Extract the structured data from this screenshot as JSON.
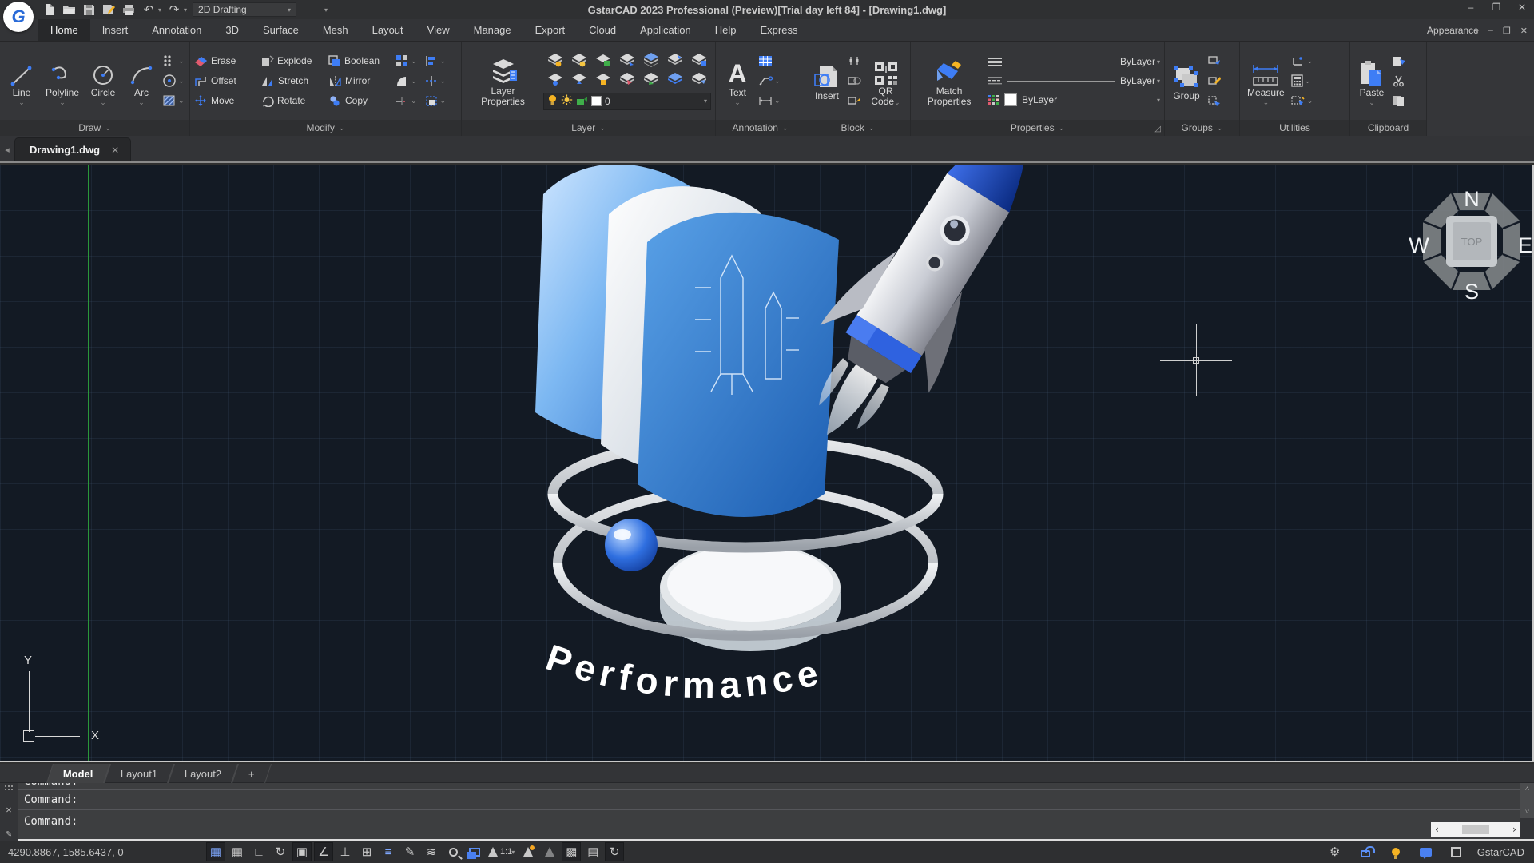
{
  "titlebar": {
    "title": "GstarCAD 2023 Professional (Preview)[Trial day left 84] - [Drawing1.dwg]",
    "workspace": "2D Drafting",
    "logo": "G"
  },
  "menubar": {
    "items": [
      "Home",
      "Insert",
      "Annotation",
      "3D",
      "Surface",
      "Mesh",
      "Layout",
      "View",
      "Manage",
      "Export",
      "Cloud",
      "Application",
      "Help",
      "Express"
    ],
    "appearance": "Appearance"
  },
  "ribbon": {
    "draw": {
      "label": "Draw",
      "line": "Line",
      "polyline": "Polyline",
      "circle": "Circle",
      "arc": "Arc"
    },
    "modify": {
      "label": "Modify",
      "erase": "Erase",
      "explode": "Explode",
      "boolean": "Boolean",
      "offset": "Offset",
      "stretch": "Stretch",
      "mirror": "Mirror",
      "move": "Move",
      "rotate": "Rotate",
      "copy": "Copy"
    },
    "layer": {
      "label": "Layer",
      "properties": "Layer Properties",
      "current": "0"
    },
    "annotation": {
      "label": "Annotation",
      "text": "Text"
    },
    "block": {
      "label": "Block",
      "insert": "Insert",
      "qr": "QR Code"
    },
    "properties": {
      "label": "Properties",
      "match": "Match Properties",
      "lineweight": "ByLayer",
      "linetype": "ByLayer",
      "color": "ByLayer"
    },
    "groups": {
      "label": "Groups",
      "group": "Group"
    },
    "utilities": {
      "label": "Utilities",
      "measure": "Measure"
    },
    "clipboard": {
      "label": "Clipboard",
      "paste": "Paste"
    }
  },
  "doc_tabs": {
    "active": "Drawing1.dwg"
  },
  "canvas": {
    "splash_text": "Performance",
    "viewcube": {
      "n": "N",
      "e": "E",
      "s": "S",
      "w": "W",
      "top": "TOP"
    },
    "ucs": {
      "x": "X",
      "y": "Y"
    }
  },
  "layout_tabs": {
    "model": "Model",
    "layout1": "Layout1",
    "layout2": "Layout2",
    "add": "+"
  },
  "command": {
    "line1": "Command:",
    "line2": "Command:",
    "prompt": "Command:"
  },
  "statusbar": {
    "coords": "4290.8867, 1585.6437, 0",
    "scale": "1:1",
    "brand": "GstarCAD"
  },
  "icons": {
    "dropdown": "▾",
    "chevron": "⌄",
    "undo": "↶",
    "redo": "↷",
    "minimize": "–",
    "maximize": "❐",
    "close": "✕",
    "tab_prev": "◂",
    "scroll_up": "˄",
    "scroll_down": "˅",
    "scroll_left": "‹",
    "scroll_right": "›",
    "pencil": "✎",
    "gear": "⚙",
    "snap": "▦",
    "grid": "▦",
    "ortho": "∟",
    "polar": "↻",
    "osnap": "▣",
    "otrack": "∠",
    "ducs": "⊥",
    "dyninput": "⊞",
    "lineweight": "≡",
    "qprops": "✎",
    "isolate": "≋",
    "checker": "▩",
    "table": "▤",
    "sync": "↻",
    "launcher": "◿"
  }
}
